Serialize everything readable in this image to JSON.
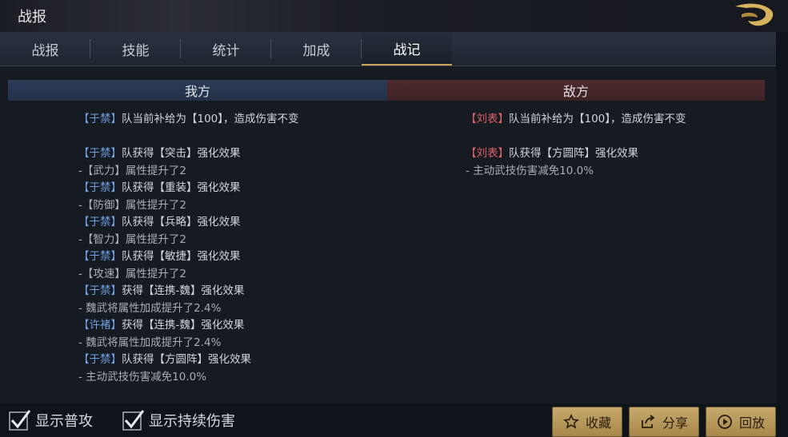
{
  "window": {
    "title": "战报"
  },
  "tabs": [
    "战报",
    "技能",
    "统计",
    "加成",
    "战记"
  ],
  "active_tab_index": 4,
  "columns": {
    "left": "我方",
    "right": "敌方"
  },
  "left_log": [
    [
      {
        "t": "【于禁】",
        "c": "b"
      },
      {
        "t": "队当前补给为【100】，造成伤害不变",
        "c": "w"
      }
    ],
    [],
    [
      {
        "t": "【于禁】",
        "c": "b"
      },
      {
        "t": "队获得【突击】强化效果",
        "c": "w"
      }
    ],
    [
      {
        "t": "-【武力】属性提升了2",
        "c": "d"
      }
    ],
    [
      {
        "t": "【于禁】",
        "c": "b"
      },
      {
        "t": "队获得【重装】强化效果",
        "c": "w"
      }
    ],
    [
      {
        "t": "-【防御】属性提升了2",
        "c": "d"
      }
    ],
    [
      {
        "t": "【于禁】",
        "c": "b"
      },
      {
        "t": "队获得【兵略】强化效果",
        "c": "w"
      }
    ],
    [
      {
        "t": "-【智力】属性提升了2",
        "c": "d"
      }
    ],
    [
      {
        "t": "【于禁】",
        "c": "b"
      },
      {
        "t": "队获得【敏捷】强化效果",
        "c": "w"
      }
    ],
    [
      {
        "t": "-【攻速】属性提升了2",
        "c": "d"
      }
    ],
    [
      {
        "t": "【于禁】",
        "c": "b"
      },
      {
        "t": "获得【连携-魏】强化效果",
        "c": "w"
      }
    ],
    [
      {
        "t": "- 魏武将属性加成提升了2.4%",
        "c": "d"
      }
    ],
    [
      {
        "t": "【许褚】",
        "c": "b"
      },
      {
        "t": "获得【连携-魏】强化效果",
        "c": "w"
      }
    ],
    [
      {
        "t": "- 魏武将属性加成提升了2.4%",
        "c": "d"
      }
    ],
    [
      {
        "t": "【于禁】",
        "c": "b"
      },
      {
        "t": "队获得【方圆阵】强化效果",
        "c": "w"
      }
    ],
    [
      {
        "t": "- 主动武技伤害减免10.0%",
        "c": "d"
      }
    ]
  ],
  "right_log": [
    [
      {
        "t": "【刘表】",
        "c": "r"
      },
      {
        "t": "队当前补给为【100】，造成伤害不变",
        "c": "w"
      }
    ],
    [],
    [
      {
        "t": "【刘表】",
        "c": "r"
      },
      {
        "t": "队获得【方圆阵】强化效果",
        "c": "w"
      }
    ],
    [
      {
        "t": "- 主动武技伤害减免10.0%",
        "c": "d"
      }
    ]
  ],
  "toggles": {
    "show_normal_attack": "显示普攻",
    "show_dot": "显示持续伤害"
  },
  "buttons": {
    "favorite": "收藏",
    "share": "分享",
    "replay": "回放"
  }
}
